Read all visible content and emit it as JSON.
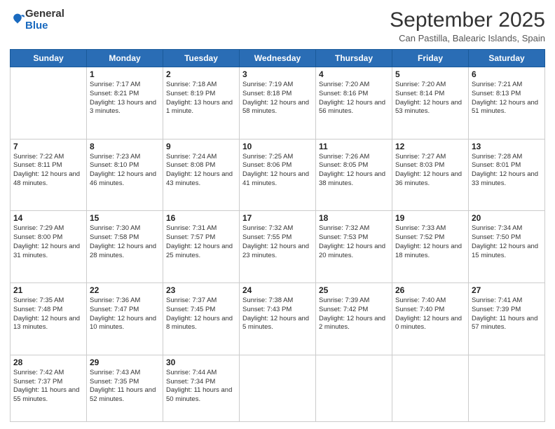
{
  "header": {
    "logo_general": "General",
    "logo_blue": "Blue",
    "title": "September 2025",
    "location": "Can Pastilla, Balearic Islands, Spain"
  },
  "weekdays": [
    "Sunday",
    "Monday",
    "Tuesday",
    "Wednesday",
    "Thursday",
    "Friday",
    "Saturday"
  ],
  "weeks": [
    [
      {
        "day": "",
        "sunrise": "",
        "sunset": "",
        "daylight": ""
      },
      {
        "day": "1",
        "sunrise": "Sunrise: 7:17 AM",
        "sunset": "Sunset: 8:21 PM",
        "daylight": "Daylight: 13 hours and 3 minutes."
      },
      {
        "day": "2",
        "sunrise": "Sunrise: 7:18 AM",
        "sunset": "Sunset: 8:19 PM",
        "daylight": "Daylight: 13 hours and 1 minute."
      },
      {
        "day": "3",
        "sunrise": "Sunrise: 7:19 AM",
        "sunset": "Sunset: 8:18 PM",
        "daylight": "Daylight: 12 hours and 58 minutes."
      },
      {
        "day": "4",
        "sunrise": "Sunrise: 7:20 AM",
        "sunset": "Sunset: 8:16 PM",
        "daylight": "Daylight: 12 hours and 56 minutes."
      },
      {
        "day": "5",
        "sunrise": "Sunrise: 7:20 AM",
        "sunset": "Sunset: 8:14 PM",
        "daylight": "Daylight: 12 hours and 53 minutes."
      },
      {
        "day": "6",
        "sunrise": "Sunrise: 7:21 AM",
        "sunset": "Sunset: 8:13 PM",
        "daylight": "Daylight: 12 hours and 51 minutes."
      }
    ],
    [
      {
        "day": "7",
        "sunrise": "Sunrise: 7:22 AM",
        "sunset": "Sunset: 8:11 PM",
        "daylight": "Daylight: 12 hours and 48 minutes."
      },
      {
        "day": "8",
        "sunrise": "Sunrise: 7:23 AM",
        "sunset": "Sunset: 8:10 PM",
        "daylight": "Daylight: 12 hours and 46 minutes."
      },
      {
        "day": "9",
        "sunrise": "Sunrise: 7:24 AM",
        "sunset": "Sunset: 8:08 PM",
        "daylight": "Daylight: 12 hours and 43 minutes."
      },
      {
        "day": "10",
        "sunrise": "Sunrise: 7:25 AM",
        "sunset": "Sunset: 8:06 PM",
        "daylight": "Daylight: 12 hours and 41 minutes."
      },
      {
        "day": "11",
        "sunrise": "Sunrise: 7:26 AM",
        "sunset": "Sunset: 8:05 PM",
        "daylight": "Daylight: 12 hours and 38 minutes."
      },
      {
        "day": "12",
        "sunrise": "Sunrise: 7:27 AM",
        "sunset": "Sunset: 8:03 PM",
        "daylight": "Daylight: 12 hours and 36 minutes."
      },
      {
        "day": "13",
        "sunrise": "Sunrise: 7:28 AM",
        "sunset": "Sunset: 8:01 PM",
        "daylight": "Daylight: 12 hours and 33 minutes."
      }
    ],
    [
      {
        "day": "14",
        "sunrise": "Sunrise: 7:29 AM",
        "sunset": "Sunset: 8:00 PM",
        "daylight": "Daylight: 12 hours and 31 minutes."
      },
      {
        "day": "15",
        "sunrise": "Sunrise: 7:30 AM",
        "sunset": "Sunset: 7:58 PM",
        "daylight": "Daylight: 12 hours and 28 minutes."
      },
      {
        "day": "16",
        "sunrise": "Sunrise: 7:31 AM",
        "sunset": "Sunset: 7:57 PM",
        "daylight": "Daylight: 12 hours and 25 minutes."
      },
      {
        "day": "17",
        "sunrise": "Sunrise: 7:32 AM",
        "sunset": "Sunset: 7:55 PM",
        "daylight": "Daylight: 12 hours and 23 minutes."
      },
      {
        "day": "18",
        "sunrise": "Sunrise: 7:32 AM",
        "sunset": "Sunset: 7:53 PM",
        "daylight": "Daylight: 12 hours and 20 minutes."
      },
      {
        "day": "19",
        "sunrise": "Sunrise: 7:33 AM",
        "sunset": "Sunset: 7:52 PM",
        "daylight": "Daylight: 12 hours and 18 minutes."
      },
      {
        "day": "20",
        "sunrise": "Sunrise: 7:34 AM",
        "sunset": "Sunset: 7:50 PM",
        "daylight": "Daylight: 12 hours and 15 minutes."
      }
    ],
    [
      {
        "day": "21",
        "sunrise": "Sunrise: 7:35 AM",
        "sunset": "Sunset: 7:48 PM",
        "daylight": "Daylight: 12 hours and 13 minutes."
      },
      {
        "day": "22",
        "sunrise": "Sunrise: 7:36 AM",
        "sunset": "Sunset: 7:47 PM",
        "daylight": "Daylight: 12 hours and 10 minutes."
      },
      {
        "day": "23",
        "sunrise": "Sunrise: 7:37 AM",
        "sunset": "Sunset: 7:45 PM",
        "daylight": "Daylight: 12 hours and 8 minutes."
      },
      {
        "day": "24",
        "sunrise": "Sunrise: 7:38 AM",
        "sunset": "Sunset: 7:43 PM",
        "daylight": "Daylight: 12 hours and 5 minutes."
      },
      {
        "day": "25",
        "sunrise": "Sunrise: 7:39 AM",
        "sunset": "Sunset: 7:42 PM",
        "daylight": "Daylight: 12 hours and 2 minutes."
      },
      {
        "day": "26",
        "sunrise": "Sunrise: 7:40 AM",
        "sunset": "Sunset: 7:40 PM",
        "daylight": "Daylight: 12 hours and 0 minutes."
      },
      {
        "day": "27",
        "sunrise": "Sunrise: 7:41 AM",
        "sunset": "Sunset: 7:39 PM",
        "daylight": "Daylight: 11 hours and 57 minutes."
      }
    ],
    [
      {
        "day": "28",
        "sunrise": "Sunrise: 7:42 AM",
        "sunset": "Sunset: 7:37 PM",
        "daylight": "Daylight: 11 hours and 55 minutes."
      },
      {
        "day": "29",
        "sunrise": "Sunrise: 7:43 AM",
        "sunset": "Sunset: 7:35 PM",
        "daylight": "Daylight: 11 hours and 52 minutes."
      },
      {
        "day": "30",
        "sunrise": "Sunrise: 7:44 AM",
        "sunset": "Sunset: 7:34 PM",
        "daylight": "Daylight: 11 hours and 50 minutes."
      },
      {
        "day": "",
        "sunrise": "",
        "sunset": "",
        "daylight": ""
      },
      {
        "day": "",
        "sunrise": "",
        "sunset": "",
        "daylight": ""
      },
      {
        "day": "",
        "sunrise": "",
        "sunset": "",
        "daylight": ""
      },
      {
        "day": "",
        "sunrise": "",
        "sunset": "",
        "daylight": ""
      }
    ]
  ]
}
